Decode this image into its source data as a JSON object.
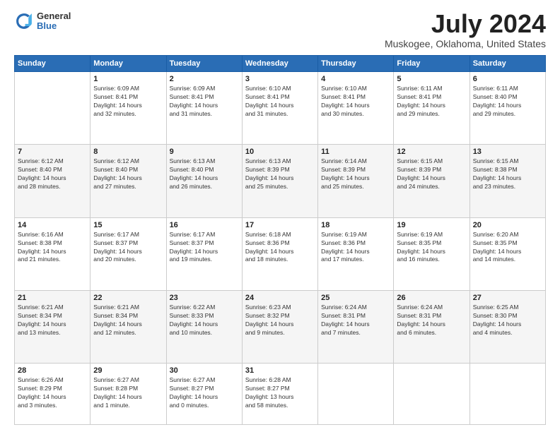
{
  "logo": {
    "general": "General",
    "blue": "Blue"
  },
  "title": {
    "month": "July 2024",
    "location": "Muskogee, Oklahoma, United States"
  },
  "weekdays": [
    "Sunday",
    "Monday",
    "Tuesday",
    "Wednesday",
    "Thursday",
    "Friday",
    "Saturday"
  ],
  "weeks": [
    [
      {
        "day": "",
        "info": ""
      },
      {
        "day": "1",
        "info": "Sunrise: 6:09 AM\nSunset: 8:41 PM\nDaylight: 14 hours\nand 32 minutes."
      },
      {
        "day": "2",
        "info": "Sunrise: 6:09 AM\nSunset: 8:41 PM\nDaylight: 14 hours\nand 31 minutes."
      },
      {
        "day": "3",
        "info": "Sunrise: 6:10 AM\nSunset: 8:41 PM\nDaylight: 14 hours\nand 31 minutes."
      },
      {
        "day": "4",
        "info": "Sunrise: 6:10 AM\nSunset: 8:41 PM\nDaylight: 14 hours\nand 30 minutes."
      },
      {
        "day": "5",
        "info": "Sunrise: 6:11 AM\nSunset: 8:41 PM\nDaylight: 14 hours\nand 29 minutes."
      },
      {
        "day": "6",
        "info": "Sunrise: 6:11 AM\nSunset: 8:40 PM\nDaylight: 14 hours\nand 29 minutes."
      }
    ],
    [
      {
        "day": "7",
        "info": "Sunrise: 6:12 AM\nSunset: 8:40 PM\nDaylight: 14 hours\nand 28 minutes."
      },
      {
        "day": "8",
        "info": "Sunrise: 6:12 AM\nSunset: 8:40 PM\nDaylight: 14 hours\nand 27 minutes."
      },
      {
        "day": "9",
        "info": "Sunrise: 6:13 AM\nSunset: 8:40 PM\nDaylight: 14 hours\nand 26 minutes."
      },
      {
        "day": "10",
        "info": "Sunrise: 6:13 AM\nSunset: 8:39 PM\nDaylight: 14 hours\nand 25 minutes."
      },
      {
        "day": "11",
        "info": "Sunrise: 6:14 AM\nSunset: 8:39 PM\nDaylight: 14 hours\nand 25 minutes."
      },
      {
        "day": "12",
        "info": "Sunrise: 6:15 AM\nSunset: 8:39 PM\nDaylight: 14 hours\nand 24 minutes."
      },
      {
        "day": "13",
        "info": "Sunrise: 6:15 AM\nSunset: 8:38 PM\nDaylight: 14 hours\nand 23 minutes."
      }
    ],
    [
      {
        "day": "14",
        "info": "Sunrise: 6:16 AM\nSunset: 8:38 PM\nDaylight: 14 hours\nand 21 minutes."
      },
      {
        "day": "15",
        "info": "Sunrise: 6:17 AM\nSunset: 8:37 PM\nDaylight: 14 hours\nand 20 minutes."
      },
      {
        "day": "16",
        "info": "Sunrise: 6:17 AM\nSunset: 8:37 PM\nDaylight: 14 hours\nand 19 minutes."
      },
      {
        "day": "17",
        "info": "Sunrise: 6:18 AM\nSunset: 8:36 PM\nDaylight: 14 hours\nand 18 minutes."
      },
      {
        "day": "18",
        "info": "Sunrise: 6:19 AM\nSunset: 8:36 PM\nDaylight: 14 hours\nand 17 minutes."
      },
      {
        "day": "19",
        "info": "Sunrise: 6:19 AM\nSunset: 8:35 PM\nDaylight: 14 hours\nand 16 minutes."
      },
      {
        "day": "20",
        "info": "Sunrise: 6:20 AM\nSunset: 8:35 PM\nDaylight: 14 hours\nand 14 minutes."
      }
    ],
    [
      {
        "day": "21",
        "info": "Sunrise: 6:21 AM\nSunset: 8:34 PM\nDaylight: 14 hours\nand 13 minutes."
      },
      {
        "day": "22",
        "info": "Sunrise: 6:21 AM\nSunset: 8:34 PM\nDaylight: 14 hours\nand 12 minutes."
      },
      {
        "day": "23",
        "info": "Sunrise: 6:22 AM\nSunset: 8:33 PM\nDaylight: 14 hours\nand 10 minutes."
      },
      {
        "day": "24",
        "info": "Sunrise: 6:23 AM\nSunset: 8:32 PM\nDaylight: 14 hours\nand 9 minutes."
      },
      {
        "day": "25",
        "info": "Sunrise: 6:24 AM\nSunset: 8:31 PM\nDaylight: 14 hours\nand 7 minutes."
      },
      {
        "day": "26",
        "info": "Sunrise: 6:24 AM\nSunset: 8:31 PM\nDaylight: 14 hours\nand 6 minutes."
      },
      {
        "day": "27",
        "info": "Sunrise: 6:25 AM\nSunset: 8:30 PM\nDaylight: 14 hours\nand 4 minutes."
      }
    ],
    [
      {
        "day": "28",
        "info": "Sunrise: 6:26 AM\nSunset: 8:29 PM\nDaylight: 14 hours\nand 3 minutes."
      },
      {
        "day": "29",
        "info": "Sunrise: 6:27 AM\nSunset: 8:28 PM\nDaylight: 14 hours\nand 1 minute."
      },
      {
        "day": "30",
        "info": "Sunrise: 6:27 AM\nSunset: 8:27 PM\nDaylight: 14 hours\nand 0 minutes."
      },
      {
        "day": "31",
        "info": "Sunrise: 6:28 AM\nSunset: 8:27 PM\nDaylight: 13 hours\nand 58 minutes."
      },
      {
        "day": "",
        "info": ""
      },
      {
        "day": "",
        "info": ""
      },
      {
        "day": "",
        "info": ""
      }
    ]
  ]
}
